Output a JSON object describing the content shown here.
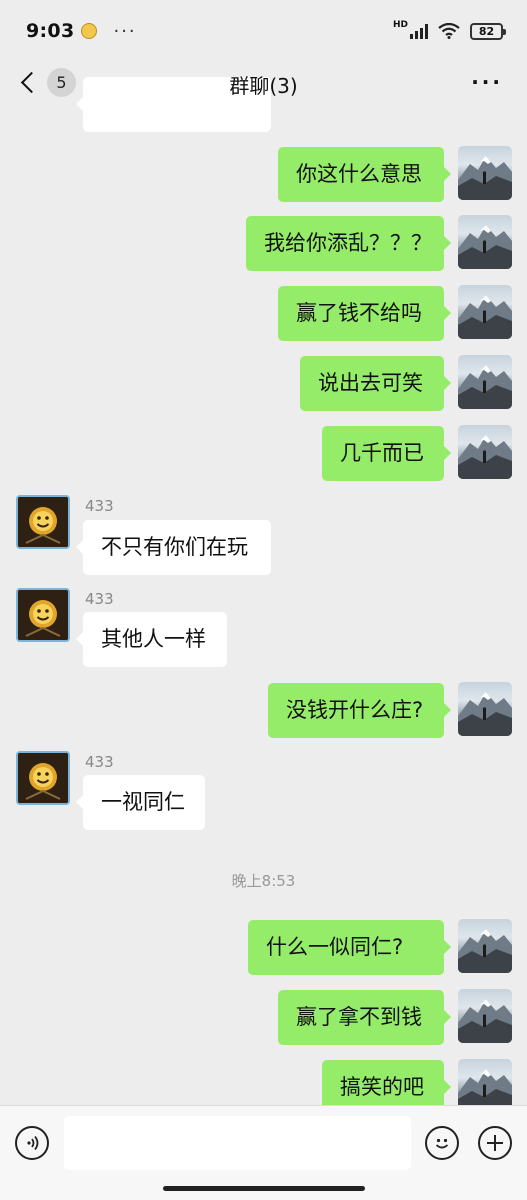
{
  "status": {
    "time": "9:03",
    "dots": "···",
    "battery": "82",
    "hd": "HD"
  },
  "nav": {
    "title": "群聊(3)",
    "unread": "5",
    "more": "···"
  },
  "messages": [
    {
      "side": "me",
      "text": "你这什么意思"
    },
    {
      "side": "me",
      "text": "我给你添乱？？？"
    },
    {
      "side": "me",
      "text": "赢了钱不给吗"
    },
    {
      "side": "me",
      "text": "说出去可笑"
    },
    {
      "side": "me",
      "text": "几千而已"
    },
    {
      "side": "other",
      "sender": "433",
      "text": "不只有你们在玩"
    },
    {
      "side": "other",
      "sender": "433",
      "text": "其他人一样"
    },
    {
      "side": "me",
      "text": "没钱开什么庄?"
    },
    {
      "side": "other",
      "sender": "433",
      "text": "一视同仁"
    },
    {
      "side": "time",
      "text": "晚上8:53"
    },
    {
      "side": "me",
      "text": "什么一似同仁?"
    },
    {
      "side": "me",
      "text": "赢了拿不到钱"
    },
    {
      "side": "me",
      "text": "搞笑的吧"
    }
  ],
  "icons": {
    "back": "chevron-left-icon",
    "voice": "voice-icon",
    "emoji": "emoji-icon",
    "plus": "plus-icon",
    "wifi": "wifi-icon",
    "signal": "signal-icon"
  },
  "colors": {
    "my_bubble": "#95ec69",
    "other_bubble": "#ffffff",
    "background": "#ededed"
  }
}
